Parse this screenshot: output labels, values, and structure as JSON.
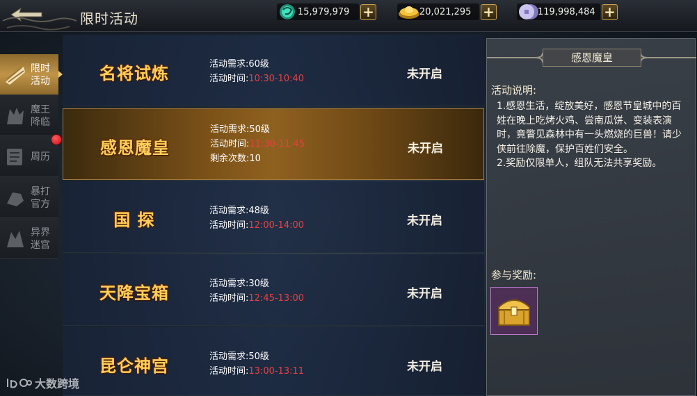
{
  "header": {
    "title": "限时活动",
    "currencies": [
      {
        "name": "jade",
        "value": "15,979,979",
        "icon": "jade-ring-icon",
        "color": "#37c9a8"
      },
      {
        "name": "gold",
        "value": "20,021,295",
        "icon": "gold-ingot-icon",
        "color": "#e7b52c"
      },
      {
        "name": "silver",
        "value": "119,998,484",
        "icon": "silver-coin-icon",
        "color": "#b9b3e6"
      }
    ],
    "plus_label": "+"
  },
  "sidebar": {
    "items": [
      {
        "label_line1": "限时",
        "label_line2": "活动",
        "icon": "scroll-fan-icon",
        "active": true
      },
      {
        "label_line1": "魔王",
        "label_line2": "降临",
        "icon": "demon-icon",
        "active": false
      },
      {
        "label_line1": "周历",
        "label_line2": "",
        "icon": "calendar-scroll-icon",
        "active": false
      },
      {
        "label_line1": "暴打",
        "label_line2": "官方",
        "icon": "fist-icon",
        "active": false
      },
      {
        "label_line1": "异界",
        "label_line2": "迷宫",
        "icon": "maze-icon",
        "active": false
      }
    ]
  },
  "activities": [
    {
      "name": "名将试炼",
      "req": "活动需求:60级",
      "time_label": "活动时间:",
      "time": "10:30-10:40",
      "extra": "",
      "status": "未开启",
      "selected": false
    },
    {
      "name": "感恩魔皇",
      "req": "活动需求:50级",
      "time_label": "活动时间:",
      "time": "11:30-11:45",
      "extra": "剩余次数:10",
      "status": "未开启",
      "selected": true
    },
    {
      "name": "国 探",
      "req": "活动需求:48级",
      "time_label": "活动时间:",
      "time": "12:00-14:00",
      "extra": "",
      "status": "未开启",
      "selected": false
    },
    {
      "name": "天降宝箱",
      "req": "活动需求:30级",
      "time_label": "活动时间:",
      "time": "12:45-13:00",
      "extra": "",
      "status": "未开启",
      "selected": false
    },
    {
      "name": "昆仑神宫",
      "req": "活动需求:50级",
      "time_label": "活动时间:",
      "time": "13:00-13:11",
      "extra": "",
      "status": "未开启",
      "selected": false
    }
  ],
  "detail": {
    "title": "感恩魔皇",
    "desc_heading": "活动说明:",
    "desc_line1": "1.感恩生活，绽放美好，感恩节皇城中的百姓在晚上吃烤火鸡、尝南瓜饼、变装表演时，竟瞥见森林中有一头燃烧的巨兽！请少侠前往除魔，保护百姓们安全。",
    "desc_line2": "2.奖励仅限单人，组队无法共享奖励。",
    "reward_heading": "参与奖励:",
    "reward_icon": "golden-chest-icon"
  },
  "watermark": {
    "text": "大数跨境"
  }
}
